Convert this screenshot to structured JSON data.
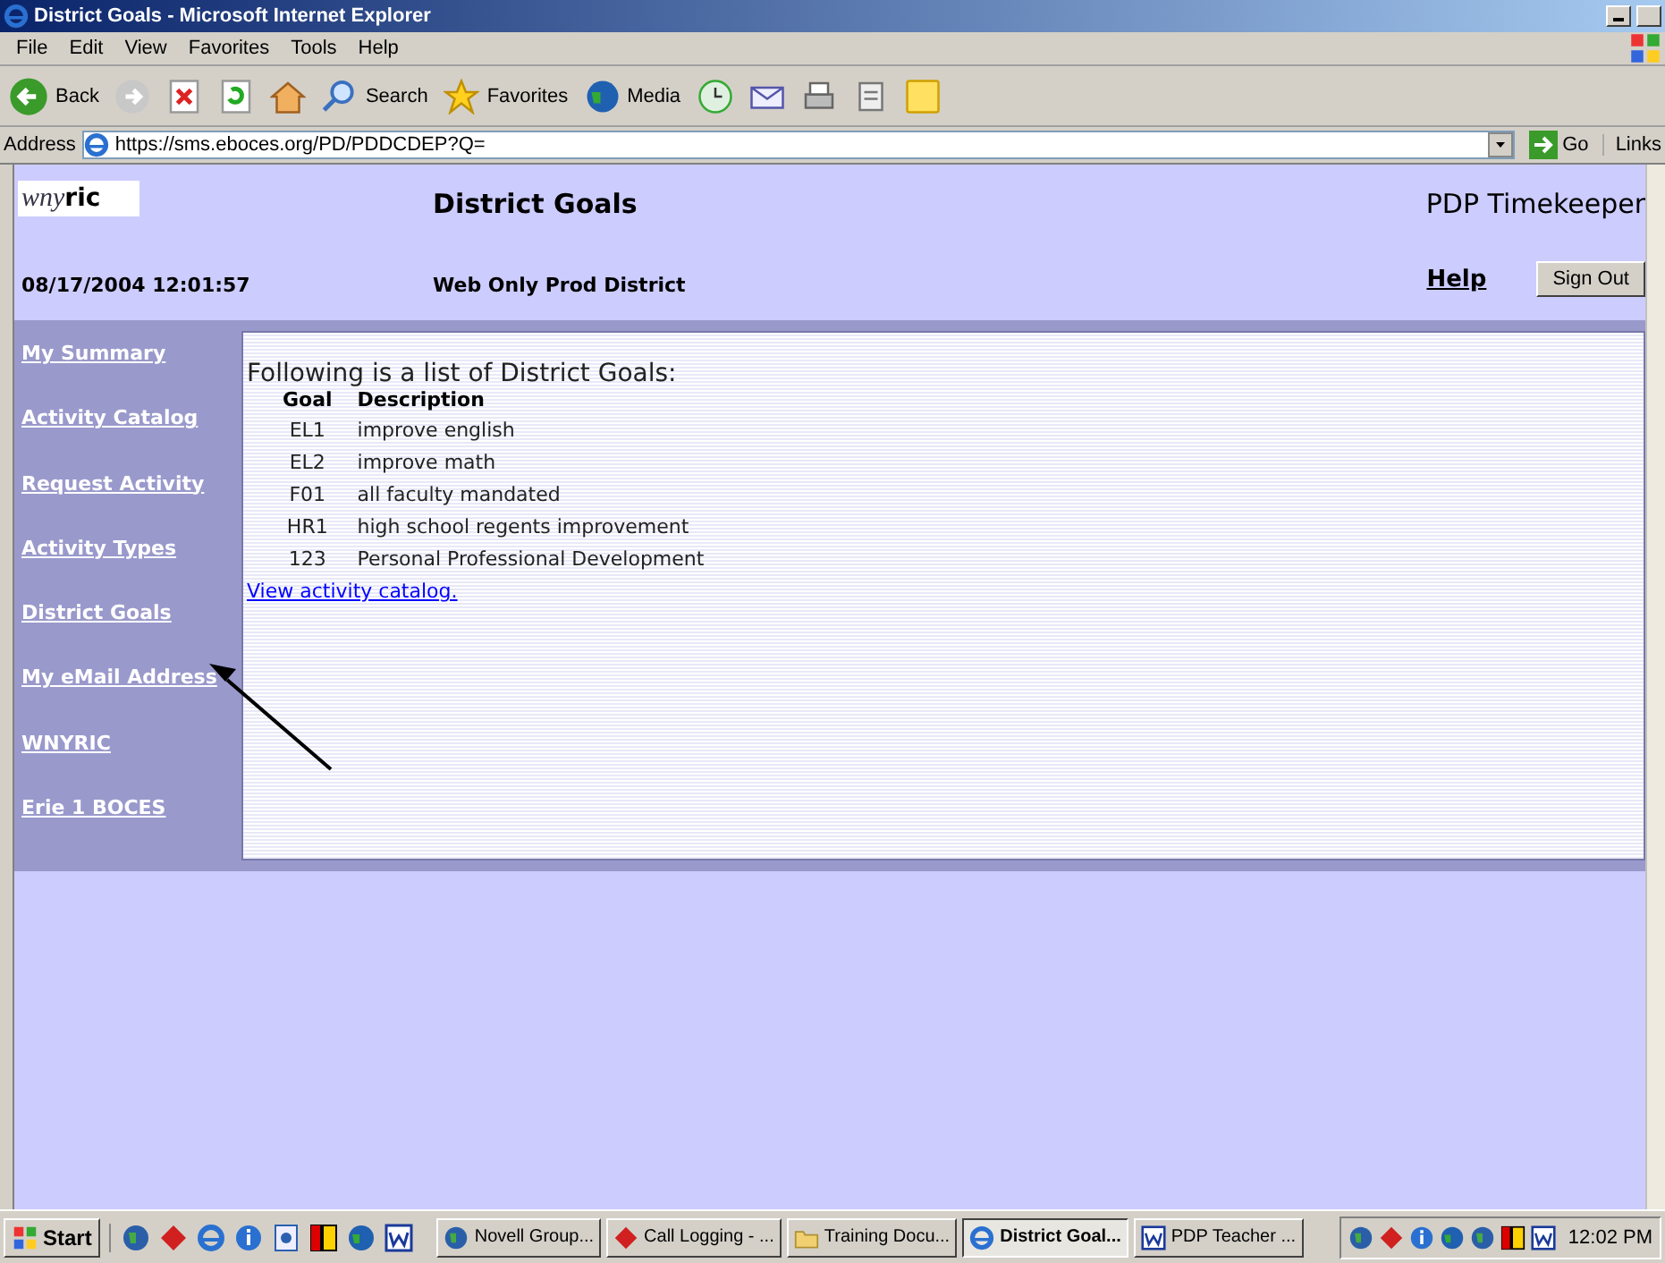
{
  "window": {
    "title": "District Goals - Microsoft Internet Explorer"
  },
  "menu": [
    "File",
    "Edit",
    "View",
    "Favorites",
    "Tools",
    "Help"
  ],
  "toolbar": [
    {
      "kind": "back",
      "label": "Back"
    },
    {
      "kind": "forward"
    },
    {
      "kind": "stop"
    },
    {
      "kind": "refresh"
    },
    {
      "kind": "home"
    },
    {
      "kind": "search",
      "label": "Search"
    },
    {
      "kind": "favorites",
      "label": "Favorites"
    },
    {
      "kind": "media",
      "label": "Media"
    },
    {
      "kind": "history"
    },
    {
      "kind": "mail"
    },
    {
      "kind": "print"
    },
    {
      "kind": "edit"
    },
    {
      "kind": "note"
    }
  ],
  "address": {
    "label": "Address",
    "url": "https://sms.eboces.org/PD/PDDCDEP?Q=",
    "go": "Go",
    "links": "Links"
  },
  "page": {
    "logo": {
      "light": "wny",
      "bold": "ric"
    },
    "title": "District Goals",
    "product": "PDP Timekeeper",
    "datetime": "08/17/2004 12:01:57",
    "district": "Web Only Prod District",
    "help": "Help",
    "sign_out": "Sign Out",
    "nav": [
      "My Summary",
      "Activity Catalog",
      "Request Activity",
      "Activity Types",
      "District Goals",
      "My eMail Address",
      "WNYRIC",
      "Erie 1 BOCES"
    ],
    "intro": "Following is a list of District Goals:",
    "columns": [
      "Goal",
      "Description"
    ],
    "rows": [
      [
        "EL1",
        "improve english"
      ],
      [
        "EL2",
        "improve math"
      ],
      [
        "F01",
        "all faculty mandated"
      ],
      [
        "HR1",
        "high school regents improvement"
      ],
      [
        "123",
        "Personal Professional Development"
      ]
    ],
    "link": "View activity catalog."
  },
  "taskbar": {
    "start": "Start",
    "quick_launch": [
      {
        "kind": "globe"
      },
      {
        "kind": "diamond"
      },
      {
        "kind": "ie"
      },
      {
        "kind": "info"
      },
      {
        "kind": "doc"
      },
      {
        "kind": "grid"
      },
      {
        "kind": "media"
      },
      {
        "kind": "word"
      }
    ],
    "tasks": [
      {
        "label": "Novell Group...",
        "kind": "globe",
        "selected": false
      },
      {
        "label": "Call Logging - ...",
        "kind": "diamond",
        "selected": false
      },
      {
        "label": "Training Docu...",
        "kind": "folder",
        "selected": false
      },
      {
        "label": "District Goal...",
        "kind": "ie",
        "selected": true
      },
      {
        "label": "PDP Teacher ...",
        "kind": "word",
        "selected": false
      }
    ],
    "tray": [
      {
        "kind": "globe"
      },
      {
        "kind": "diamond"
      },
      {
        "kind": "info"
      },
      {
        "kind": "media"
      },
      {
        "kind": "globe"
      },
      {
        "kind": "grid"
      },
      {
        "kind": "word"
      }
    ],
    "clock": "12:02 PM"
  }
}
